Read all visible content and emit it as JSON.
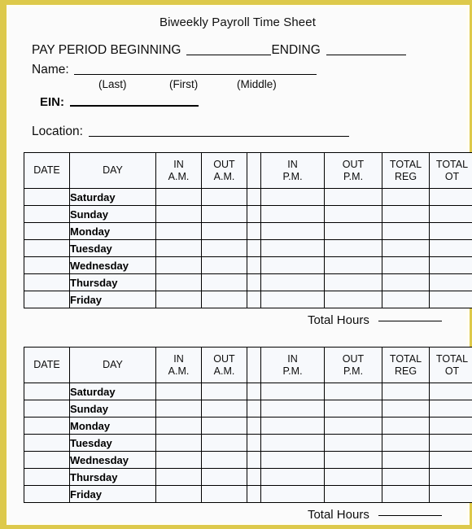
{
  "document": {
    "title": "Biweekly Payroll Time Sheet"
  },
  "form": {
    "pay_period_label": "PAY PERIOD BEGINNING",
    "ending_label": "ENDING",
    "name_label": "Name:",
    "name_parts": {
      "last": "(Last)",
      "first": "(First)",
      "middle": "(Middle)"
    },
    "ein_label": "EIN:",
    "location_label": "Location:"
  },
  "table": {
    "headers": {
      "date": "DATE",
      "day": "DAY",
      "in_am_line1": "IN",
      "in_am_line2": "A.M.",
      "out_am_line1": "OUT",
      "out_am_line2": "A.M.",
      "in_pm_line1": "IN",
      "in_pm_line2": "P.M.",
      "out_pm_line1": "OUT",
      "out_pm_line2": "P.M.",
      "total_reg_line1": "TOTAL",
      "total_reg_line2": "REG",
      "total_ot_line1": "TOTAL",
      "total_ot_line2": "OT"
    },
    "days": [
      "Saturday",
      "Sunday",
      "Monday",
      "Tuesday",
      "Wednesday",
      "Thursday",
      "Friday"
    ],
    "total_hours_label": "Total Hours"
  },
  "colors": {
    "frame": "#ddc94a",
    "page": "#fbfbfb",
    "cell": "#f7f9fc",
    "divider": "#8e8e8e",
    "ink": "#000000"
  }
}
